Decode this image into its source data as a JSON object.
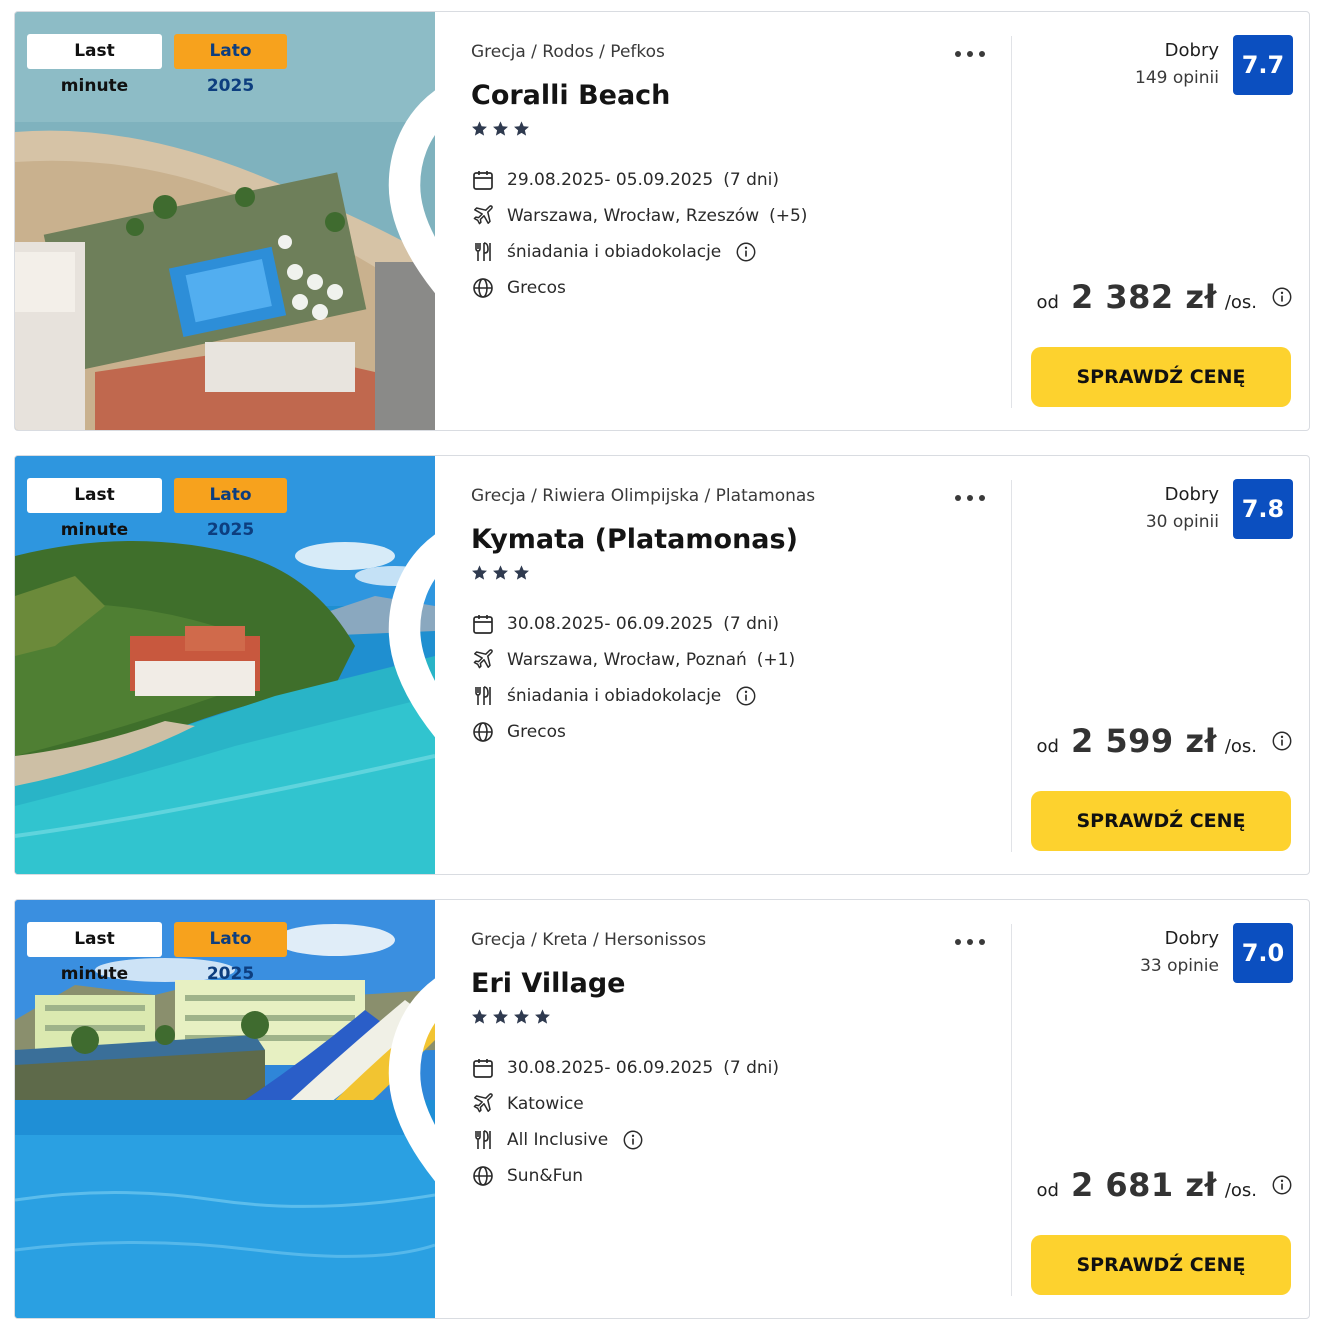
{
  "offers": [
    {
      "badge_last_minute": "Last minute",
      "badge_season": "Lato 2025",
      "breadcrumb": "Grecja / Rodos / Pefkos",
      "name": "Coralli Beach",
      "stars": 3,
      "dates": "29.08.2025- 05.09.2025",
      "duration": "(7 dni)",
      "departures": "Warszawa, Wrocław, Rzeszów",
      "departures_extra": "(+5)",
      "board": "śniadania i obiadokolacje",
      "operator": "Grecos",
      "rating_label": "Dobry",
      "rating_count": "149 opinii",
      "score": "7.7",
      "price_from": "od",
      "price": "2 382 zł",
      "price_unit": "/os.",
      "cta": "SPRAWDŹ CENĘ",
      "photo": "aerial-beach-resort"
    },
    {
      "badge_last_minute": "Last minute",
      "badge_season": "Lato 2025",
      "breadcrumb": "Grecja / Riwiera Olimpijska / Platamonas",
      "name": "Kymata (Platamonas)",
      "stars": 3,
      "dates": "30.08.2025- 06.09.2025",
      "duration": "(7 dni)",
      "departures": "Warszawa, Wrocław, Poznań",
      "departures_extra": "(+1)",
      "board": "śniadania i obiadokolacje",
      "operator": "Grecos",
      "rating_label": "Dobry",
      "rating_count": "30 opinii",
      "score": "7.8",
      "price_from": "od",
      "price": "2 599 zł",
      "price_unit": "/os.",
      "cta": "SPRAWDŹ CENĘ",
      "photo": "coastal-hillside-hotel"
    },
    {
      "badge_last_minute": "Last minute",
      "badge_season": "Lato 2025",
      "breadcrumb": "Grecja / Kreta / Hersonissos",
      "name": "Eri Village",
      "stars": 4,
      "dates": "30.08.2025- 06.09.2025",
      "duration": "(7 dni)",
      "departures": "Katowice",
      "departures_extra": "",
      "board": "All Inclusive",
      "operator": "Sun&Fun",
      "rating_label": "Dobry",
      "rating_count": "33 opinie",
      "score": "7.0",
      "price_from": "od",
      "price": "2 681 zł",
      "price_unit": "/os.",
      "cta": "SPRAWDŹ CENĘ",
      "photo": "waterpark-pool-hotel"
    }
  ],
  "colors": {
    "score_bg": "#0b4fc0",
    "cta_bg": "#fdd22e",
    "season_badge_bg": "#f7a21d",
    "season_badge_text": "#0d3e7f",
    "star": "#2f3a4f"
  }
}
